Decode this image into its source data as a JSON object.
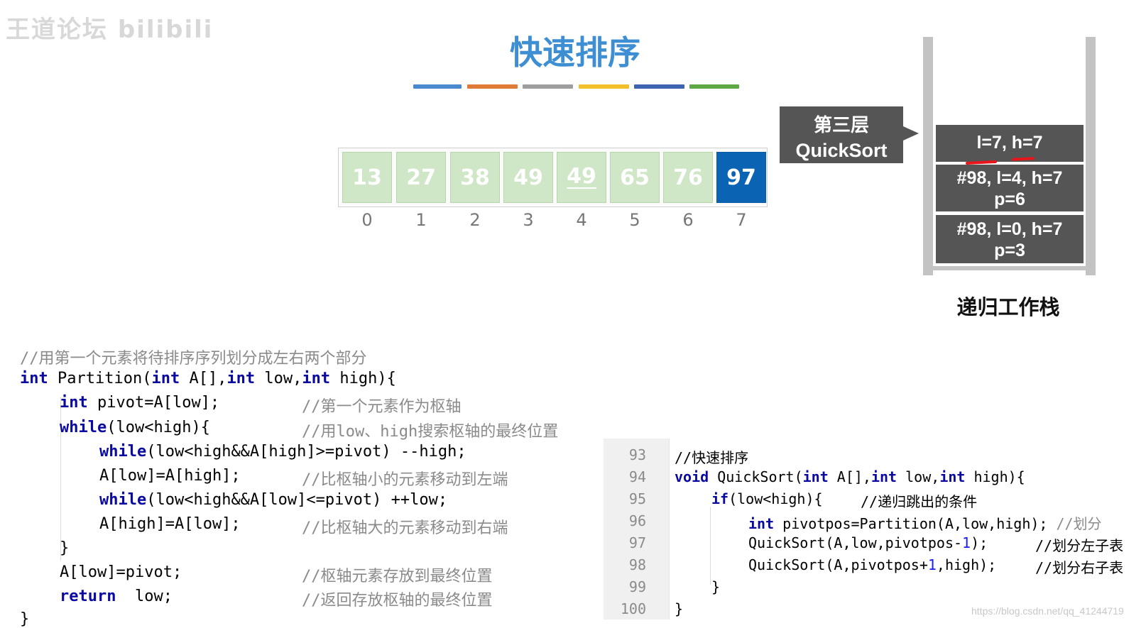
{
  "watermark": "王道论坛 bilibili",
  "title": "快速排序",
  "color_bar": [
    "#4a8ad0",
    "#e07a37",
    "#9e9e9e",
    "#f2bf2b",
    "#3e64b1",
    "#5da845"
  ],
  "array": {
    "values": [
      "13",
      "27",
      "38",
      "49",
      "49",
      "65",
      "76",
      "97"
    ],
    "indices": [
      "0",
      "1",
      "2",
      "3",
      "4",
      "5",
      "6",
      "7"
    ],
    "active_index": 7,
    "cell_color": "#cfe6c7",
    "active_color": "#0b63b3"
  },
  "layer_tag": {
    "line1": "第三层",
    "line2": "QuickSort"
  },
  "stack": {
    "frames": [
      {
        "lines": [
          "l=7, h=7"
        ]
      },
      {
        "lines": [
          "#98, l=4, h=7",
          "p=6"
        ]
      },
      {
        "lines": [
          "#98, l=0, h=7",
          "p=3"
        ]
      }
    ],
    "label": "递归工作栈"
  },
  "partition_code": {
    "l1": "//用第一个元素将待排序序列划分成左右两个部分",
    "l2_kw1": "int",
    "l2_a": " Partition(",
    "l2_kw2": "int",
    "l2_b": " A[],",
    "l2_kw3": "int",
    "l2_c": " low,",
    "l2_kw4": "int",
    "l2_d": " high){",
    "l3_kw": "int",
    "l3_a": " pivot=A[low];",
    "l3_cm": "//第一个元素作为枢轴",
    "l4_kw": "while",
    "l4_a": "(low<high){",
    "l4_cm": "//用low、high搜索枢轴的最终位置",
    "l5_kw": "while",
    "l5_a": "(low<high&&A[high]>=pivot) --high;",
    "l6_a": "A[low]=A[high];",
    "l6_cm": "//比枢轴小的元素移动到左端",
    "l7_kw": "while",
    "l7_a": "(low<high&&A[low]<=pivot) ++low;",
    "l8_a": "A[high]=A[low];",
    "l8_cm": "//比枢轴大的元素移动到右端",
    "l9": "}",
    "l10_a": "A[low]=pivot;",
    "l10_cm": "//枢轴元素存放到最终位置",
    "l11_kw": "return",
    "l11_a": "  low;",
    "l11_cm": "//返回存放枢轴的最终位置",
    "l12": "}"
  },
  "editor": {
    "line_numbers": [
      "93",
      "94",
      "95",
      "96",
      "97",
      "98",
      "99",
      "100"
    ],
    "l93": "//快速排序",
    "l94_kw1": "void",
    "l94_a": " QuickSort(",
    "l94_kw2": "int",
    "l94_b": " A[],",
    "l94_kw3": "int",
    "l94_c": " low,",
    "l94_kw4": "int",
    "l94_d": " high){",
    "l95_kw": "if",
    "l95_a": "(low<high){",
    "l95_cm": "//递归跳出的条件",
    "l96_kw": "int",
    "l96_a": " pivotpos=Partition(A,low,high);",
    "l96_cm": " //划分",
    "l97_a": "QuickSort(A,low,pivotpos-",
    "l97_n": "1",
    "l97_b": ");",
    "l97_cm": "//划分左子表",
    "l98_a": "QuickSort(A,pivotpos+",
    "l98_n": "1",
    "l98_b": ",high);",
    "l98_cm": "//划分右子表",
    "l99": "}",
    "l100": "}"
  },
  "csdn_watermark": "https://blog.csdn.net/qq_41244719"
}
